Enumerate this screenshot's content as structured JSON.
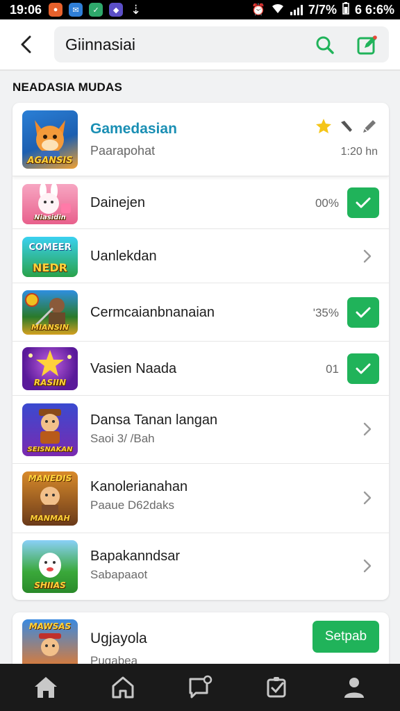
{
  "status_bar": {
    "time": "19:06",
    "battery": "7/7%",
    "clock_right": "6 6:6%"
  },
  "header": {
    "search_value": "Giinnasiai",
    "back_icon": "chevron-left-icon",
    "search_icon": "search-icon",
    "edit_icon": "edit-icon"
  },
  "section": {
    "title": "NEADASIA MUDAS"
  },
  "featured": {
    "title": "Gamedasian",
    "subtitle": "Paarapohat",
    "meta": "1:20 hn",
    "thumb_caption": "AGANSIS",
    "icons": [
      "star-icon",
      "wrench-icon",
      "pen-icon"
    ]
  },
  "rows": [
    {
      "title": "Dainejen",
      "subtitle": "",
      "percent": "00%",
      "action": "check",
      "thumb_caption": "Niasidin"
    },
    {
      "title": "Uanlekdan",
      "subtitle": "",
      "percent": "",
      "action": "chevron",
      "thumb_caption": "NEDR"
    },
    {
      "title": "Cermcaianbnanaian",
      "subtitle": "",
      "percent": "'35%",
      "action": "check",
      "thumb_caption": "MIANSIN"
    },
    {
      "title": "Vasien Naada",
      "subtitle": "",
      "percent": "01",
      "action": "check",
      "thumb_caption": "RASIIN"
    },
    {
      "title": "Dansa Tanan langan",
      "subtitle": "Saoi 3/ /Bah",
      "percent": "",
      "action": "chevron",
      "thumb_caption": "SEISNAKAN"
    },
    {
      "title": "Kanolerianahan",
      "subtitle": "Paaue D62daks",
      "percent": "",
      "action": "chevron",
      "thumb_caption": "MANMAH"
    },
    {
      "title": "Bapakanndsar",
      "subtitle": "Sabapaaot",
      "percent": "",
      "action": "chevron",
      "thumb_caption": "SHIIAS"
    }
  ],
  "bottom_card": {
    "title": "Ugjayola",
    "subtitle": "Pugabea",
    "button_label": "Setpab",
    "thumb_caption": "MAWSAS"
  },
  "bottom_nav": [
    "home-icon",
    "house-outline-icon",
    "messages-icon",
    "checklist-icon",
    "profile-icon"
  ],
  "colors": {
    "accent_green": "#20b35a",
    "title_blue": "#1a8fb4",
    "status_bar_bg": "#000000"
  }
}
